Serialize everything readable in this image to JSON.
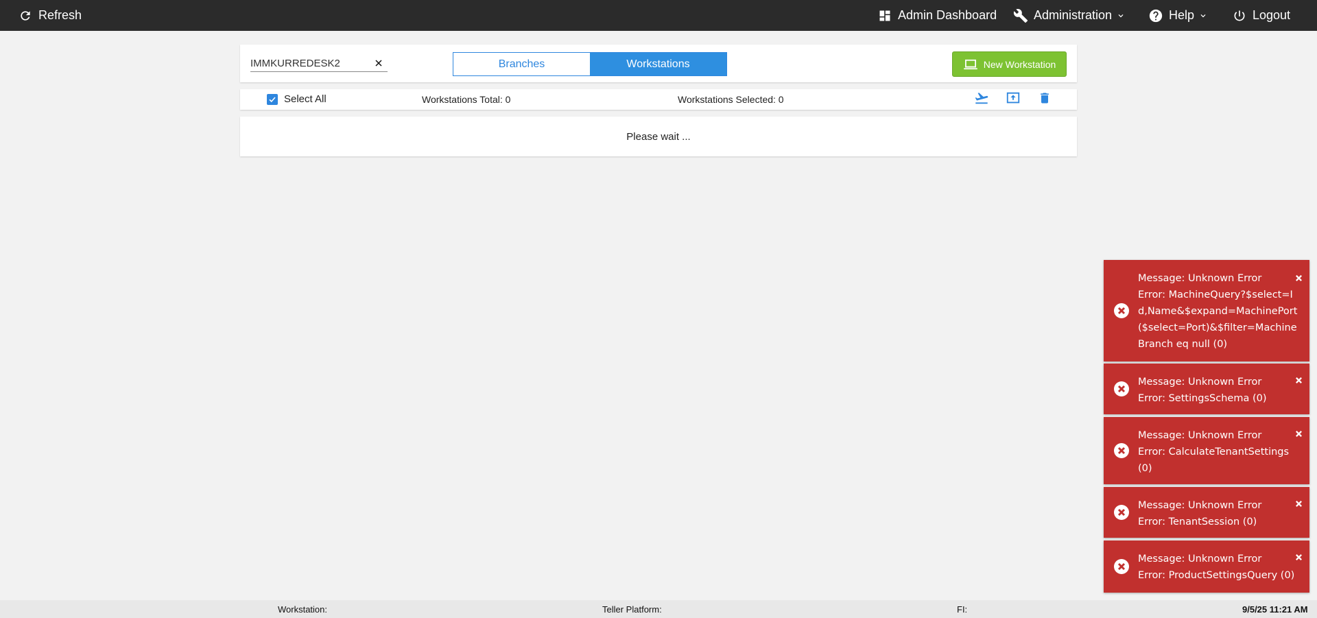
{
  "topbar": {
    "refresh_label": "Refresh",
    "admin_dashboard_label": "Admin Dashboard",
    "administration_label": "Administration",
    "help_label": "Help",
    "logout_label": "Logout",
    "background": "#2b2b2b"
  },
  "search": {
    "value": "IMMKURREDESK2"
  },
  "tabs": [
    {
      "label": "Branches",
      "active": false
    },
    {
      "label": "Workstations",
      "active": true
    }
  ],
  "new_workstation_label": "New Workstation",
  "info_bar": {
    "select_all_label": "Select All",
    "select_all_checked": true,
    "total_text": "Workstations Total: 0",
    "selected_text": "Workstations Selected: 0"
  },
  "wait_text": "Please wait ...",
  "toasts": [
    {
      "line1": "Message: Unknown Error",
      "line2": "Error: MachineQuery?$select=Id,Name&$expand=MachinePort($select=Port)&$filter=MachineBranch eq null (0)"
    },
    {
      "line1": "Message: Unknown Error",
      "line2": "Error: SettingsSchema (0)"
    },
    {
      "line1": "Message: Unknown Error",
      "line2": "Error: CalculateTenantSettings (0)"
    },
    {
      "line1": "Message: Unknown Error",
      "line2": "Error: TenantSession (0)"
    },
    {
      "line1": "Message: Unknown Error",
      "line2": "Error: ProductSettingsQuery (0)"
    }
  ],
  "footer": {
    "workstation_label": "Workstation:",
    "teller_platform_label": "Teller Platform:",
    "fi_label": "FI:",
    "datetime": "9/5/25 11:21 AM"
  },
  "colors": {
    "accent": "#2e86de",
    "success": "#7dc232",
    "error": "#c1302e"
  }
}
